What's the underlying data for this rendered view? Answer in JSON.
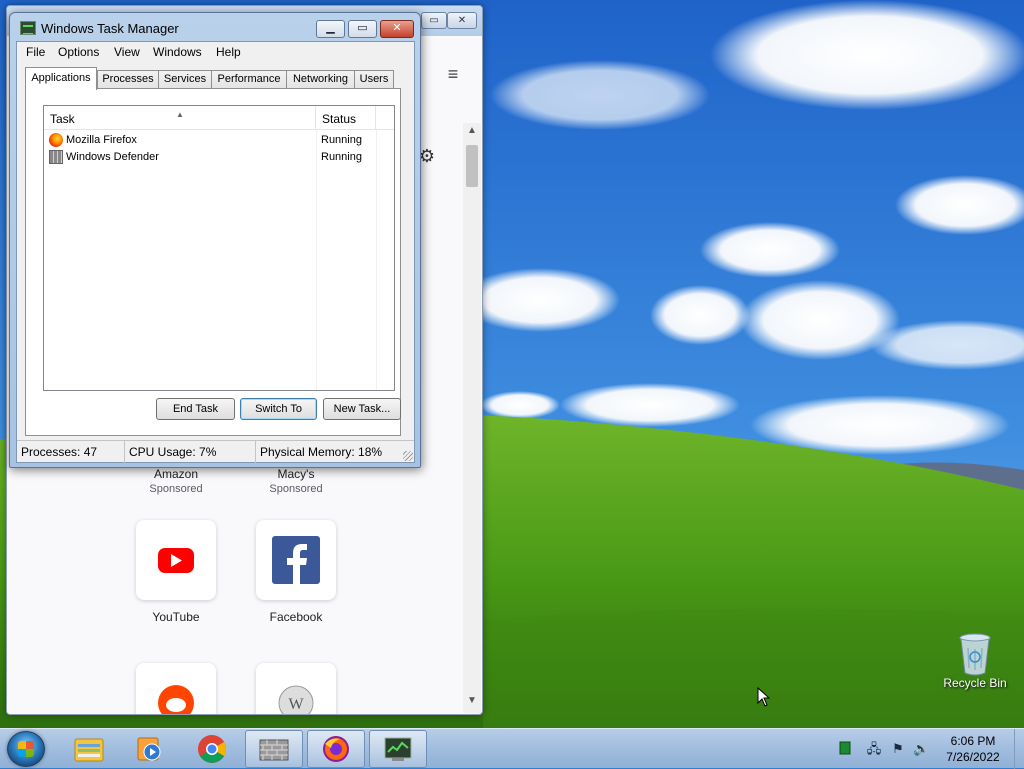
{
  "firefox": {
    "shortcuts_row1": [
      {
        "label": "Amazon",
        "sub": "Sponsored"
      },
      {
        "label": "Macy's",
        "sub": "Sponsored"
      }
    ],
    "shortcuts_row2": [
      {
        "label": "YouTube"
      },
      {
        "label": "Facebook"
      }
    ]
  },
  "task_manager": {
    "title": "Windows Task Manager",
    "menu": [
      "File",
      "Options",
      "View",
      "Windows",
      "Help"
    ],
    "tabs": [
      "Applications",
      "Processes",
      "Services",
      "Performance",
      "Networking",
      "Users"
    ],
    "active_tab": "Applications",
    "columns": {
      "task": "Task",
      "status": "Status"
    },
    "rows": [
      {
        "task": "Mozilla Firefox",
        "status": "Running",
        "icon": "firefox-icon"
      },
      {
        "task": "Windows Defender",
        "status": "Running",
        "icon": "windows-defender-icon"
      }
    ],
    "buttons": {
      "end_task": "End Task",
      "switch_to": "Switch To",
      "new_task": "New Task..."
    },
    "status": {
      "processes": "Processes: 47",
      "cpu": "CPU Usage: 7%",
      "memory": "Physical Memory: 18%"
    }
  },
  "desktop": {
    "recycle_bin": "Recycle Bin"
  },
  "taskbar": {
    "pinned": [
      "windows-explorer-icon",
      "media-player-icon",
      "chrome-icon",
      "windows-defender-icon",
      "firefox-icon",
      "task-manager-icon"
    ],
    "clock_time": "6:06 PM",
    "clock_date": "7/26/2022"
  },
  "colors": {
    "sky": "#2f7fd3",
    "grass": "#4e9a1c",
    "taskbar": "#a3bfe0",
    "task_manager_frame": "#b9d1ea"
  }
}
